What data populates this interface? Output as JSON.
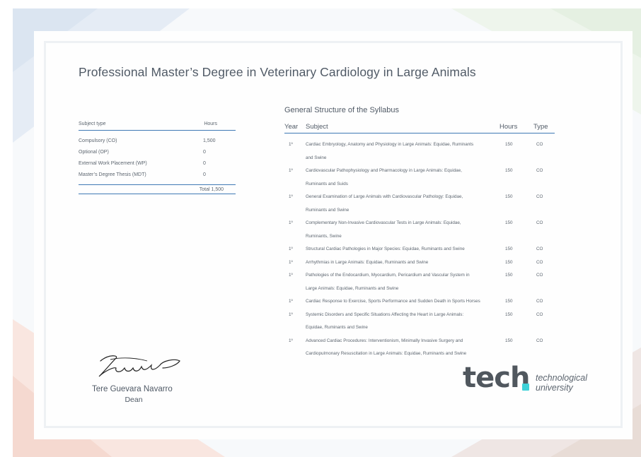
{
  "title": "Professional Master’s Degree in Veterinary Cardiology in Large Animals",
  "subject_type_table": {
    "header_type": "Subject type",
    "header_hours": "Hours",
    "rows": [
      {
        "name": "Compulsory (CO)",
        "hours": "1,500"
      },
      {
        "name": "Optional (OP)",
        "hours": "0"
      },
      {
        "name": "External Work Placement (WP)",
        "hours": "0"
      },
      {
        "name": "Master’s Degree Thesis (MDT)",
        "hours": "0"
      }
    ],
    "total": "Total 1,500"
  },
  "syllabus": {
    "title": "General Structure of the Syllabus",
    "headers": {
      "year": "Year",
      "subject": "Subject",
      "hours": "Hours",
      "type": "Type"
    },
    "rows": [
      {
        "year": "1º",
        "subject_l1": "Cardiac Embryology, Anatomy and Physiology in Large Animals: Equidae, Ruminants",
        "subject_l2": "and Swine",
        "hours": "150",
        "type": "CO"
      },
      {
        "year": "1º",
        "subject_l1": "Cardiovascular Pathophysiology and Pharmacology in Large Animals: Equidae,",
        "subject_l2": "Ruminants and Suids",
        "hours": "150",
        "type": "CO"
      },
      {
        "year": "1º",
        "subject_l1": "General Examination of Large Animals with Cardiovascular Pathology: Equidae,",
        "subject_l2": "Ruminants and Swine",
        "hours": "150",
        "type": "CO"
      },
      {
        "year": "1º",
        "subject_l1": "Complementary Non-Invasive Cardiovascular Tests in Large Animals: Equidae,",
        "subject_l2": "Ruminants, Swine",
        "hours": "150",
        "type": "CO"
      },
      {
        "year": "1º",
        "subject_l1": "Structural Cardiac Pathologies in Major Species: Equidae, Ruminants and Swine",
        "subject_l2": "",
        "hours": "150",
        "type": "CO"
      },
      {
        "year": "1º",
        "subject_l1": "Arrhythmias in Large Animals: Equidae, Ruminants and Swine",
        "subject_l2": "",
        "hours": "150",
        "type": "CO"
      },
      {
        "year": "1º",
        "subject_l1": "Pathologies of the Endocardium, Myocardium, Pericardium and Vascular System in",
        "subject_l2": "Large Animals: Equidae, Ruminants and Swine",
        "hours": "150",
        "type": "CO"
      },
      {
        "year": "1º",
        "subject_l1": "Cardiac Response to Exercise, Sports Performance and Sudden Death in Sports Horses",
        "subject_l2": "",
        "hours": "150",
        "type": "CO"
      },
      {
        "year": "1º",
        "subject_l1": "Systemic Disorders and Specific Situations Affecting the Heart in Large Animals:",
        "subject_l2": "Equidae, Ruminants and Swine",
        "hours": "150",
        "type": "CO"
      },
      {
        "year": "1º",
        "subject_l1": "Advanced Cardiac Procedures: Interventionism, Minimally Invasive Surgery and",
        "subject_l2": "Cardiopulmonary Resuscitation in Large Animals: Equidae, Ruminants and Swine",
        "hours": "150",
        "type": "CO"
      }
    ]
  },
  "signatory": {
    "name": "Tere Guevara Navarro",
    "role": "Dean"
  },
  "logo": {
    "word": "tech",
    "line1": "technological",
    "line2": "university"
  },
  "colors": {
    "accent": "#3f79b4",
    "logo_dot": "#3fd1d8",
    "text": "#505a66"
  }
}
